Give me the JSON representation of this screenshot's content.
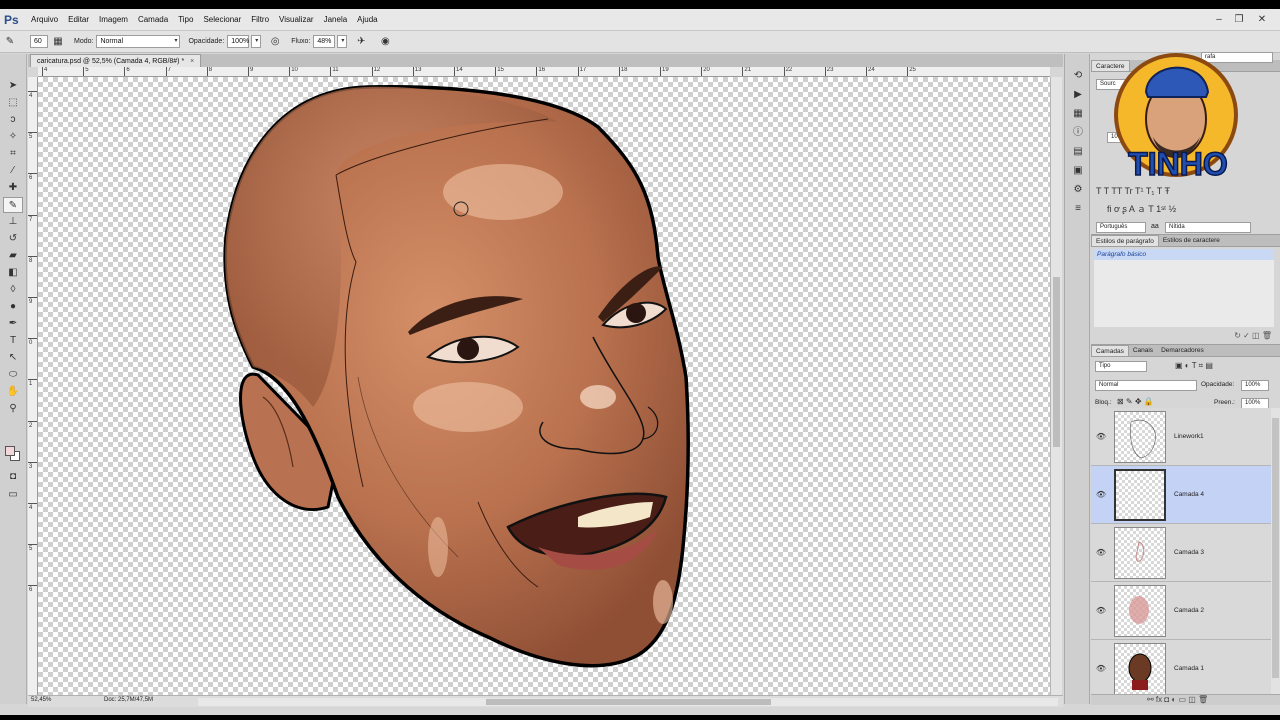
{
  "app": {
    "logo_text": "Ps",
    "menu": [
      "Arquivo",
      "Editar",
      "Imagem",
      "Camada",
      "Tipo",
      "Selecionar",
      "Filtro",
      "Visualizar",
      "Janela",
      "Ajuda"
    ],
    "window_controls": {
      "minimize": "–",
      "restore": "❐",
      "close": "✕"
    }
  },
  "options": {
    "mode_label": "Modo:",
    "mode_value": "Normal",
    "opacity_label": "Opacidade:",
    "opacity_value": "100%",
    "flow_label": "Fluxo:",
    "flow_value": "48%",
    "brush_size": "60"
  },
  "document": {
    "tab_title": "caricatura.psd @ 52,5% (Camada 4, RGB/8#) *",
    "close": "×",
    "zoom": "52,45%",
    "doc_info": "Doc: 25,7M/47,5M"
  },
  "rulers": {
    "h": [
      "4",
      "5",
      "6",
      "7",
      "8",
      "9",
      "10",
      "11",
      "12",
      "13",
      "14",
      "15",
      "16",
      "17",
      "18",
      "19",
      "20",
      "21",
      "22",
      "23",
      "24",
      "25"
    ],
    "v": [
      "4",
      "5",
      "6",
      "7",
      "8",
      "9",
      "0",
      "1",
      "2",
      "3",
      "4",
      "5",
      "6"
    ]
  },
  "character_panel": {
    "tab": "Caractere",
    "font_family": "Sourc",
    "font_style": "rafa",
    "language": "Português",
    "aa_label": "aa",
    "antialias": "Nítida",
    "scale_value": "100"
  },
  "styles_panel": {
    "tabs": [
      "Estilos de parágrafo",
      "Estilos de caractere"
    ],
    "items": [
      "Parágrafo básico"
    ]
  },
  "layers_panel": {
    "tabs": [
      "Camadas",
      "Canais",
      "Demarcadores"
    ],
    "filter_kind": "Tipo",
    "blend_mode": "Normal",
    "opacity_label": "Opacidade:",
    "opacity_value": "100%",
    "lock_label": "Bloq.:",
    "fill_label": "Preen.:",
    "fill_value": "100%",
    "layers": [
      {
        "name": "Linework1",
        "selected": false
      },
      {
        "name": "Camada 4",
        "selected": true
      },
      {
        "name": "Camada 3",
        "selected": false
      },
      {
        "name": "Camada 2",
        "selected": false
      },
      {
        "name": "Camada 1",
        "selected": false
      }
    ]
  },
  "watermark": {
    "text": "TINHO"
  },
  "colors": {
    "skin": "#b9714e",
    "selection": "#c4d2f5",
    "logo_text": "#1f4fb0",
    "logo_ring": "#e8a21a"
  }
}
